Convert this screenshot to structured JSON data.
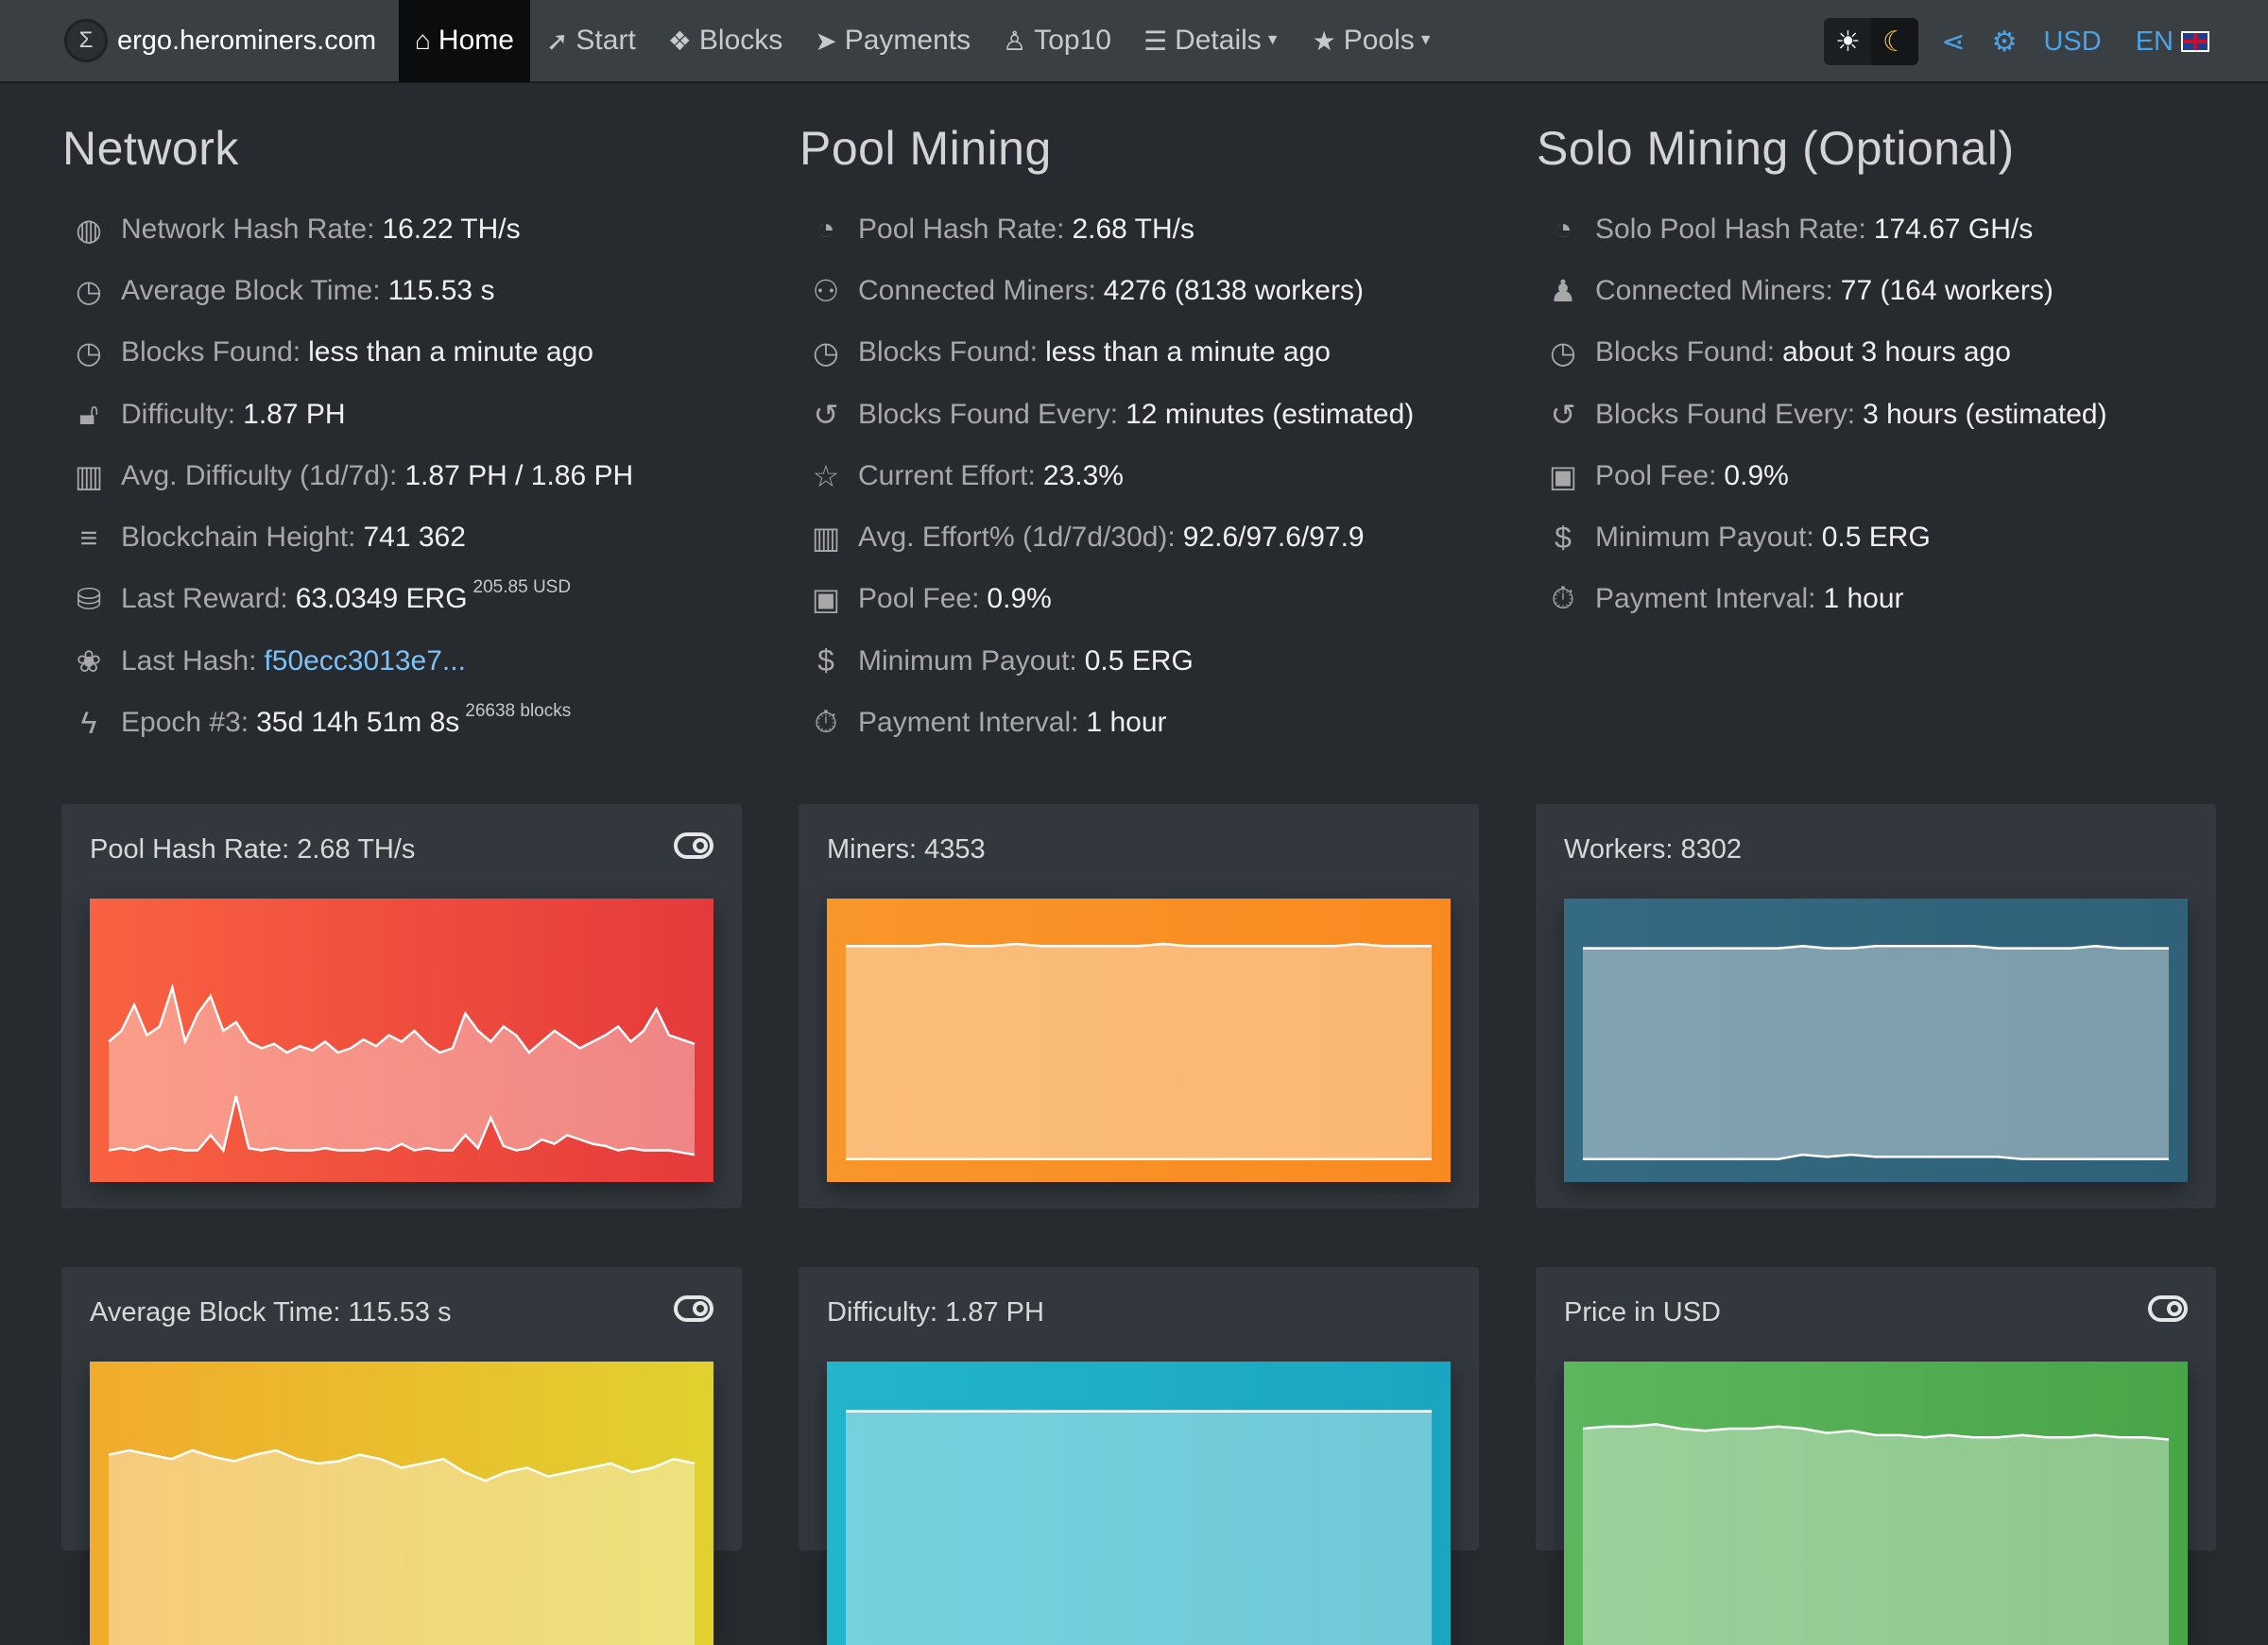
{
  "nav": {
    "brand": "ergo.herominers.com",
    "items": [
      {
        "label": "Home",
        "icon": "home-icon"
      },
      {
        "label": "Start",
        "icon": "rocket-icon"
      },
      {
        "label": "Blocks",
        "icon": "cubes-icon"
      },
      {
        "label": "Payments",
        "icon": "paper-plane-icon"
      },
      {
        "label": "Top10",
        "icon": "user-icon"
      },
      {
        "label": "Details",
        "icon": "signpost-icon"
      },
      {
        "label": "Pools",
        "icon": "star-icon"
      }
    ],
    "currency": "USD",
    "language": "EN"
  },
  "network": {
    "title": "Network",
    "rows": [
      {
        "label": "Network Hash Rate:",
        "value": "16.22 TH/s"
      },
      {
        "label": "Average Block Time:",
        "value": "115.53 s"
      },
      {
        "label": "Blocks Found:",
        "value": "less than a minute ago"
      },
      {
        "label": "Difficulty:",
        "value": "1.87 PH"
      },
      {
        "label": "Avg. Difficulty (1d/7d):",
        "value": "1.87 PH / 1.86 PH"
      },
      {
        "label": "Blockchain Height:",
        "value": "741 362"
      },
      {
        "label": "Last Reward:",
        "value": "63.0349 ERG",
        "sup": "205.85 USD"
      },
      {
        "label": "Last Hash:",
        "value": "f50ecc3013e7..."
      },
      {
        "label": "Epoch #3:",
        "value": "35d 14h 51m 8s",
        "sup": "26638 blocks"
      }
    ]
  },
  "pool": {
    "title": "Pool Mining",
    "rows": [
      {
        "label": "Pool Hash Rate:",
        "value": "2.68 TH/s"
      },
      {
        "label": "Connected Miners:",
        "value": "4276 (8138 workers)"
      },
      {
        "label": "Blocks Found:",
        "value": "less than a minute ago"
      },
      {
        "label": "Blocks Found Every:",
        "value": "12 minutes (estimated)"
      },
      {
        "label": "Current Effort:",
        "value": "23.3%"
      },
      {
        "label": "Avg. Effort% (1d/7d/30d):",
        "value": "92.6/97.6/97.9"
      },
      {
        "label": "Pool Fee:",
        "value": "0.9%"
      },
      {
        "label": "Minimum Payout:",
        "value": "0.5 ERG"
      },
      {
        "label": "Payment Interval:",
        "value": "1 hour"
      }
    ]
  },
  "solo": {
    "title": "Solo Mining (Optional)",
    "rows": [
      {
        "label": "Solo Pool Hash Rate:",
        "value": "174.67 GH/s"
      },
      {
        "label": "Connected Miners:",
        "value": "77 (164 workers)"
      },
      {
        "label": "Blocks Found:",
        "value": "about 3 hours ago"
      },
      {
        "label": "Blocks Found Every:",
        "value": "3 hours (estimated)"
      },
      {
        "label": "Pool Fee:",
        "value": "0.9%"
      },
      {
        "label": "Minimum Payout:",
        "value": "0.5 ERG"
      },
      {
        "label": "Payment Interval:",
        "value": "1 hour"
      }
    ]
  },
  "cards": [
    {
      "title": "Pool Hash Rate: 2.68 TH/s",
      "has_toggle": true,
      "colors": [
        "#f96240",
        "#e53a3c"
      ]
    },
    {
      "title": "Miners: 4353",
      "has_toggle": false,
      "colors": [
        "#f9962a",
        "#f98a20"
      ]
    },
    {
      "title": "Workers: 8302",
      "has_toggle": false,
      "colors": [
        "#346a82",
        "#2f6178"
      ]
    },
    {
      "title": "Average Block Time: 115.53 s",
      "has_toggle": true,
      "colors": [
        "#f2ab2c",
        "#e1d12e"
      ]
    },
    {
      "title": "Difficulty: 1.87 PH",
      "has_toggle": false,
      "colors": [
        "#22b5cb",
        "#1aa6c0"
      ]
    },
    {
      "title": "Price in USD",
      "has_toggle": true,
      "colors": [
        "#5cb65e",
        "#49a548"
      ]
    }
  ],
  "chart_data": [
    {
      "type": "area",
      "title": "Pool Hash Rate: 2.68 TH/s",
      "series": [
        {
          "values": [
            0.55,
            0.6,
            0.72,
            0.58,
            0.62,
            0.8,
            0.55,
            0.68,
            0.76,
            0.6,
            0.64,
            0.55,
            0.52,
            0.54,
            0.5,
            0.53,
            0.51,
            0.55,
            0.5,
            0.52,
            0.56,
            0.53,
            0.58,
            0.55,
            0.6,
            0.54,
            0.5,
            0.52,
            0.68,
            0.6,
            0.55,
            0.62,
            0.58,
            0.5,
            0.55,
            0.6,
            0.56,
            0.52,
            0.55,
            0.58,
            0.62,
            0.55,
            0.6,
            0.7,
            0.58,
            0.56,
            0.54
          ]
        },
        {
          "values": [
            0.05,
            0.06,
            0.05,
            0.07,
            0.05,
            0.06,
            0.05,
            0.05,
            0.12,
            0.05,
            0.3,
            0.06,
            0.05,
            0.06,
            0.05,
            0.05,
            0.05,
            0.06,
            0.05,
            0.05,
            0.05,
            0.06,
            0.05,
            0.08,
            0.05,
            0.06,
            0.05,
            0.05,
            0.12,
            0.06,
            0.2,
            0.07,
            0.05,
            0.06,
            0.1,
            0.08,
            0.12,
            0.1,
            0.08,
            0.07,
            0.05,
            0.06,
            0.05,
            0.05,
            0.05,
            0.04,
            0.03
          ]
        }
      ]
    },
    {
      "type": "area",
      "title": "Miners: 4353",
      "series": [
        {
          "values": [
            0.99,
            0.99,
            0.99,
            0.99,
            1.0,
            0.99,
            0.99,
            1.0,
            0.99,
            0.99,
            0.99,
            0.99,
            0.99,
            1.0,
            0.99,
            0.99,
            0.99,
            0.99,
            0.99,
            0.99,
            0.99,
            1.0,
            0.99,
            0.99,
            0.99
          ]
        },
        {
          "values": [
            0.01,
            0.01,
            0.01,
            0.01,
            0.01,
            0.01,
            0.01,
            0.01,
            0.01,
            0.01,
            0.01,
            0.01,
            0.01,
            0.01,
            0.01,
            0.01,
            0.01,
            0.01,
            0.01,
            0.01,
            0.01,
            0.01,
            0.01,
            0.01,
            0.01
          ]
        }
      ]
    },
    {
      "type": "area",
      "title": "Workers: 8302",
      "series": [
        {
          "values": [
            0.98,
            0.98,
            0.98,
            0.98,
            0.98,
            0.98,
            0.98,
            0.98,
            0.98,
            0.99,
            0.98,
            0.98,
            0.99,
            0.99,
            0.99,
            0.99,
            0.99,
            0.98,
            0.98,
            0.98,
            0.98,
            0.99,
            0.98,
            0.98,
            0.98
          ]
        },
        {
          "values": [
            0.01,
            0.01,
            0.01,
            0.01,
            0.01,
            0.01,
            0.01,
            0.01,
            0.01,
            0.03,
            0.02,
            0.03,
            0.02,
            0.02,
            0.02,
            0.02,
            0.02,
            0.02,
            0.01,
            0.01,
            0.01,
            0.01,
            0.01,
            0.01,
            0.01
          ]
        }
      ]
    },
    {
      "type": "area",
      "title": "Average Block Time: 115.53 s",
      "series": [
        {
          "values": [
            0.78,
            0.8,
            0.78,
            0.76,
            0.8,
            0.77,
            0.75,
            0.78,
            0.8,
            0.76,
            0.74,
            0.75,
            0.78,
            0.76,
            0.72,
            0.74,
            0.76,
            0.7,
            0.66,
            0.7,
            0.72,
            0.68,
            0.7,
            0.72,
            0.74,
            0.7,
            0.72,
            0.76,
            0.74
          ]
        }
      ]
    },
    {
      "type": "area",
      "title": "Difficulty: 1.87 PH",
      "series": [
        {
          "values": [
            0.98,
            0.98,
            0.98,
            0.98,
            0.98,
            0.98,
            0.98,
            0.98,
            0.98,
            0.98,
            0.98,
            0.98,
            0.98,
            0.98,
            0.98,
            0.98,
            0.98,
            0.98,
            0.98,
            0.98
          ]
        }
      ]
    },
    {
      "type": "area",
      "title": "Price in USD",
      "series": [
        {
          "values": [
            0.9,
            0.91,
            0.91,
            0.92,
            0.9,
            0.89,
            0.9,
            0.9,
            0.91,
            0.9,
            0.88,
            0.89,
            0.87,
            0.87,
            0.86,
            0.87,
            0.86,
            0.86,
            0.87,
            0.86,
            0.86,
            0.87,
            0.86,
            0.86,
            0.85
          ]
        }
      ]
    }
  ]
}
